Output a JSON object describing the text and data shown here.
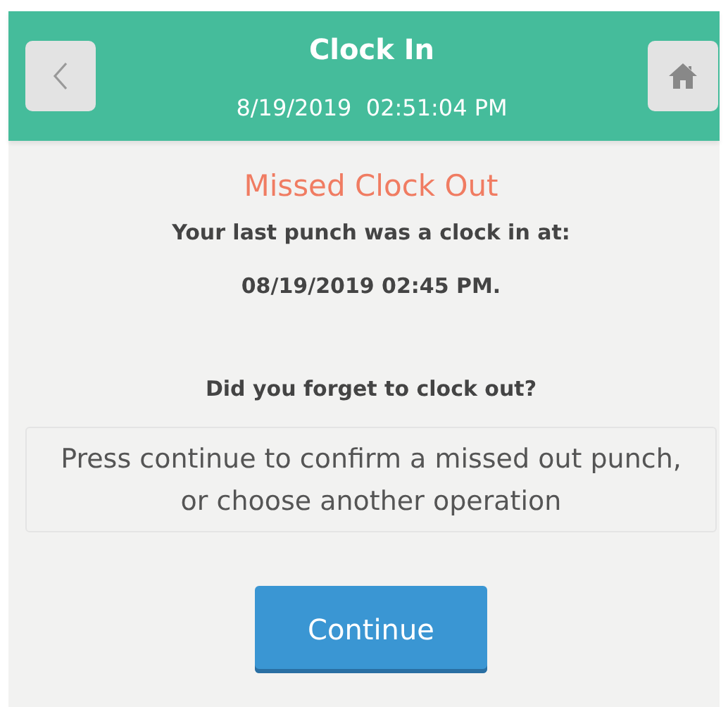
{
  "header": {
    "title": "Clock In",
    "datetime": "8/19/2019  02:51:04 PM"
  },
  "notice": {
    "heading": "Missed Clock Out",
    "line_1": "Your last punch was a clock in at:",
    "line_2": "08/19/2019 02:45 PM.",
    "question": "Did you forget to clock out?",
    "message": "Press continue to confirm a missed out punch, or choose another operation"
  },
  "buttons": [
    "Continue"
  ]
}
